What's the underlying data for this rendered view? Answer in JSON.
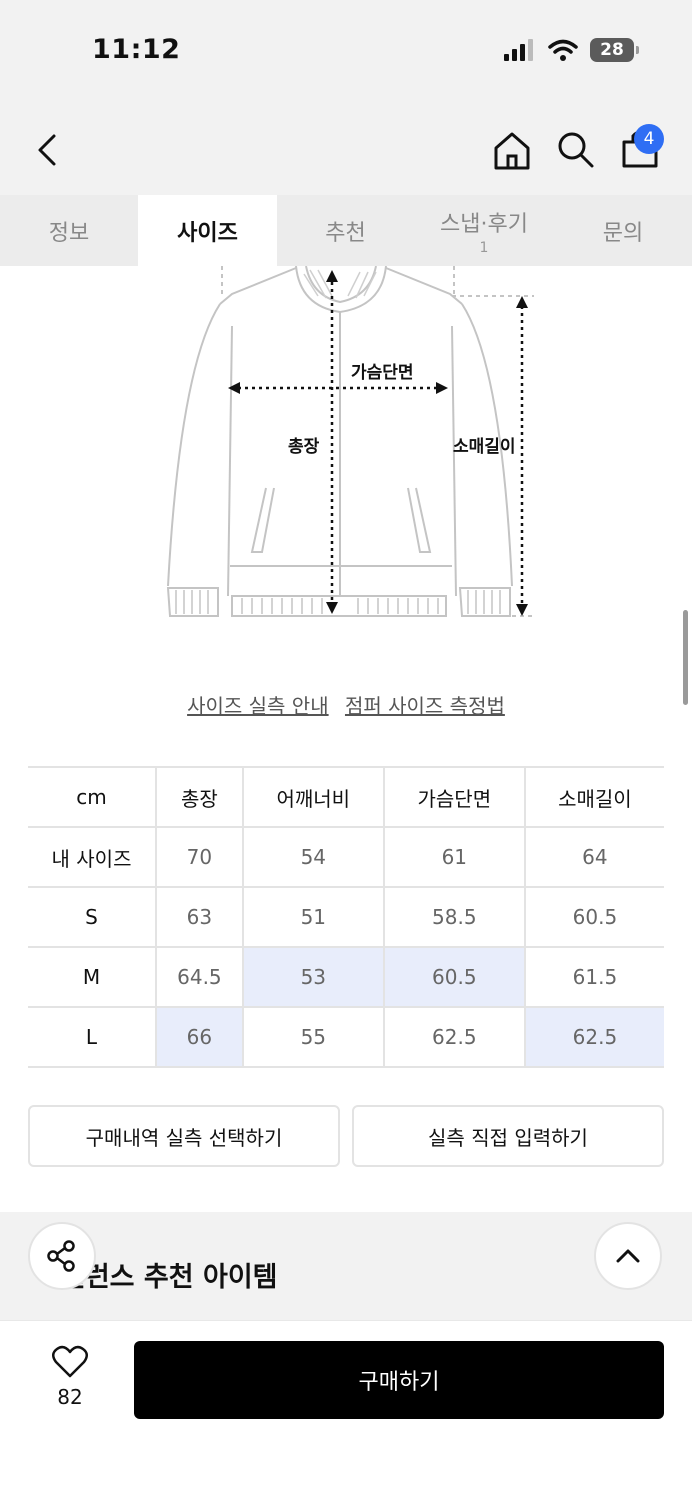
{
  "status": {
    "time": "11:12",
    "battery": "28"
  },
  "nav": {
    "cart_count": "4"
  },
  "tabs": [
    {
      "label": "정보",
      "sub": ""
    },
    {
      "label": "사이즈",
      "sub": ""
    },
    {
      "label": "추천",
      "sub": ""
    },
    {
      "label": "스냅·후기",
      "sub": "1"
    },
    {
      "label": "문의",
      "sub": ""
    }
  ],
  "diagram": {
    "chest_label": "가슴단면",
    "length_label": "총장",
    "sleeve_label": "소매길이"
  },
  "links": {
    "guide": "사이즈 실측 안내",
    "measure": "점퍼 사이즈 측정법"
  },
  "size_table": {
    "headers": [
      "cm",
      "총장",
      "어깨너비",
      "가슴단면",
      "소매길이"
    ],
    "rows": [
      [
        "내 사이즈",
        "70",
        "54",
        "61",
        "64"
      ],
      [
        "S",
        "63",
        "51",
        "58.5",
        "60.5"
      ],
      [
        "M",
        "64.5",
        "53",
        "60.5",
        "61.5"
      ],
      [
        "L",
        "66",
        "55",
        "62.5",
        "62.5"
      ]
    ]
  },
  "actions": {
    "history": "구매내역 실측 선택하기",
    "manual": "실측 직접 입력하기"
  },
  "recommend": {
    "title": "밸런스 추천 아이템"
  },
  "bottom": {
    "likes": "82",
    "buy": "구매하기"
  }
}
